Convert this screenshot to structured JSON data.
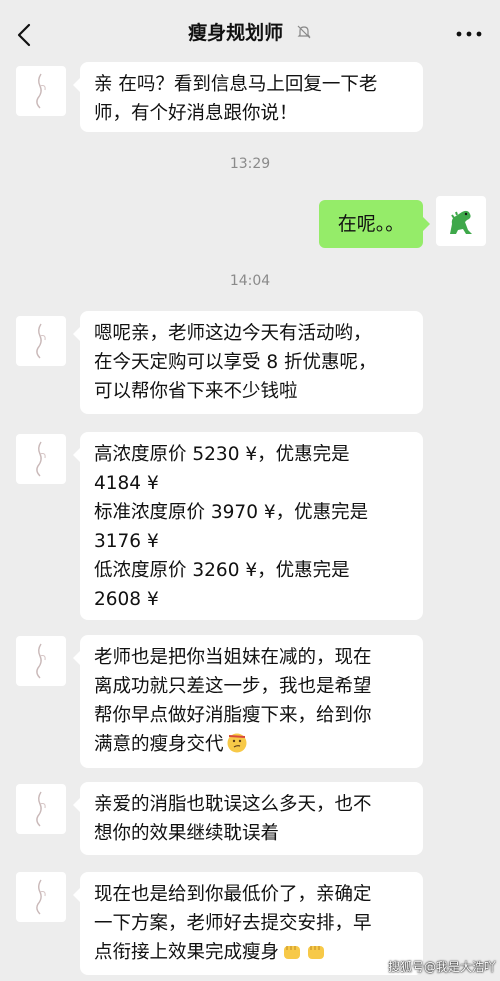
{
  "header": {
    "title": "瘦身规划师"
  },
  "messages": [
    {
      "side": "left",
      "lines": [
        "亲 在吗？看到信息马上回复一下老",
        "师，有个好消息跟你说！"
      ]
    },
    {
      "timestamp": "13:29"
    },
    {
      "side": "right",
      "text": "在呢。。"
    },
    {
      "timestamp": "14:04"
    },
    {
      "side": "left",
      "lines": [
        "嗯呢亲，老师这边今天有活动哟，",
        "在今天定购可以享受 8 折优惠呢，",
        "可以帮你省下来不少钱啦"
      ]
    },
    {
      "side": "left",
      "lines": [
        "高浓度原价 5230 ¥，优惠完是",
        "4184 ¥",
        "标准浓度原价 3970 ¥，优惠完是",
        "3176 ¥",
        "低浓度原价 3260 ¥，优惠完是",
        "2608 ¥"
      ]
    },
    {
      "side": "left",
      "lines": [
        "老师也是把你当姐妹在减的，现在",
        "离成功就只差这一步，我也是希望",
        "帮你早点做好消脂瘦下来，给到你",
        "满意的瘦身交代"
      ],
      "emoji": "thinking-face"
    },
    {
      "side": "left",
      "lines": [
        "亲爱的消脂也耽误这么多天，也不",
        "想你的效果继续耽误着"
      ]
    },
    {
      "side": "left",
      "lines": [
        "现在也是给到你最低价了，亲确定",
        "一下方案，老师好去提交安排，早",
        "点衔接上效果完成瘦身"
      ],
      "emoji": "fist-bump x2"
    }
  ],
  "watermark": "搜狐号@我是大浩吖",
  "colors": {
    "background": "#ededed",
    "incoming_bubble": "#ffffff",
    "outgoing_bubble": "#95ec69",
    "timestamp": "#8a8a8a"
  },
  "icons": {
    "back": "chevron-left-icon",
    "mute": "bell-muted-icon",
    "more": "more-dots-icon",
    "contact_avatar": "calligraphy-figure-avatar",
    "my_avatar": "green-dinosaur-avatar"
  }
}
